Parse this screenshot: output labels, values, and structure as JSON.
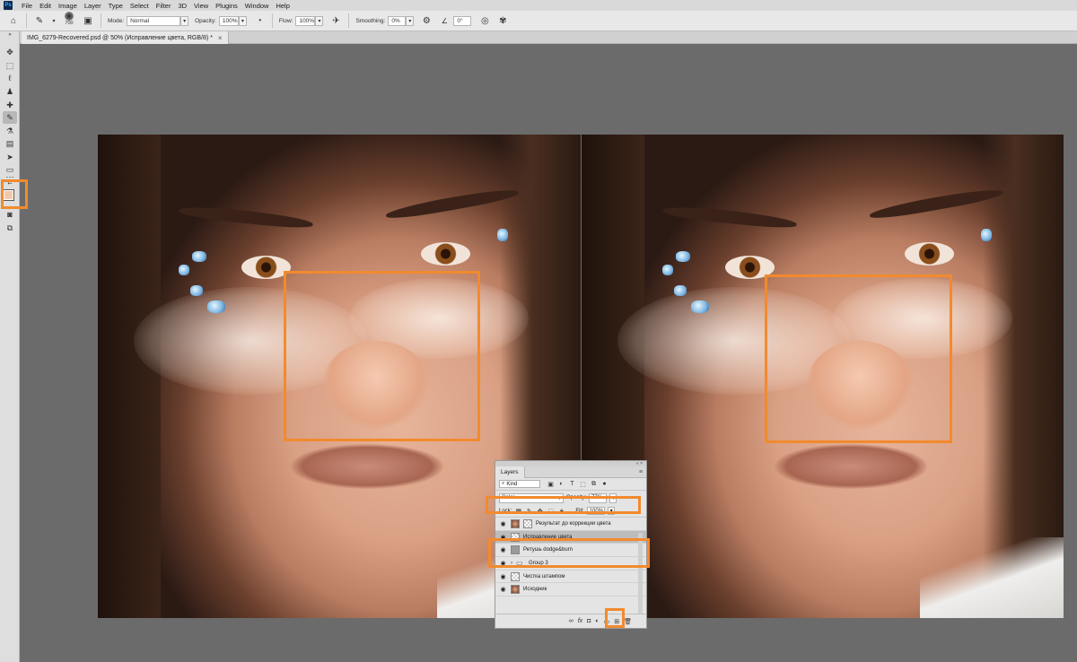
{
  "menu": [
    "File",
    "Edit",
    "Image",
    "Layer",
    "Type",
    "Select",
    "Filter",
    "3D",
    "View",
    "Plugins",
    "Window",
    "Help"
  ],
  "options": {
    "brush_size": "700",
    "mode_label": "Mode:",
    "mode_value": "Normal",
    "opacity_label": "Opacity:",
    "opacity_value": "100%",
    "flow_label": "Flow:",
    "flow_value": "100%",
    "smoothing_label": "Smoothing:",
    "smoothing_value": "0%",
    "angle_value": "0°"
  },
  "document": {
    "tab_title": "IMG_6279-Recovered.psd @ 50% (Исправление цвета, RGB/8) *",
    "close_glyph": "×"
  },
  "colors": {
    "foreground": "#f5c7a9",
    "background": "#111111",
    "highlight": "#f28a2e"
  },
  "layers_panel": {
    "title": "Layers",
    "filter_kind": "Kind",
    "blend_mode": "Color",
    "opacity_label": "Opacity:",
    "opacity_value": "77%",
    "lock_label": "Lock:",
    "fill_label": "Fill:",
    "fill_value": "100%",
    "layers": [
      {
        "name": "Результат до коррекции цвета",
        "thumb": "face",
        "selected": false,
        "visible": true
      },
      {
        "name": "Исправление цвета",
        "thumb": "check",
        "selected": true,
        "visible": true
      },
      {
        "name": "Ретушь dodge&burn",
        "thumb": "gray",
        "selected": false,
        "visible": true
      },
      {
        "name": "Group 3",
        "thumb": "folder",
        "selected": false,
        "visible": true
      },
      {
        "name": "Чистка штампом",
        "thumb": "check",
        "selected": false,
        "visible": true
      },
      {
        "name": "Исходник",
        "thumb": "face",
        "selected": false,
        "visible": true
      }
    ]
  }
}
